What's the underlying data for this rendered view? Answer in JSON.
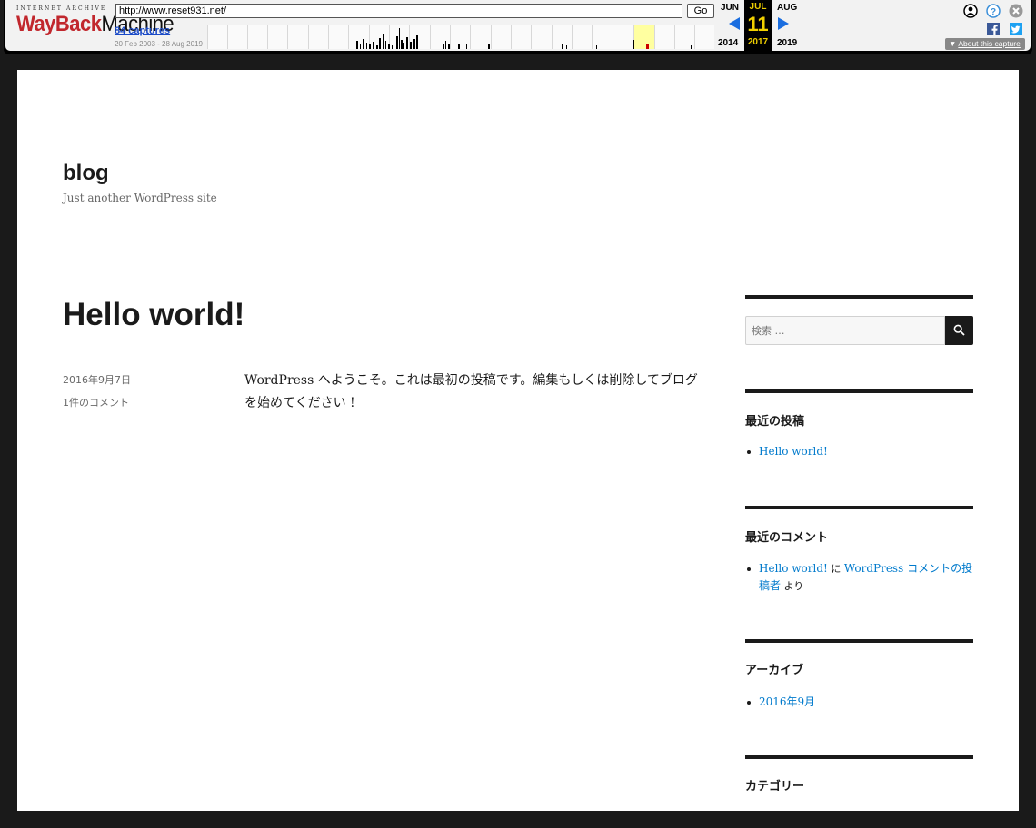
{
  "wayback": {
    "logo_top": "INTERNET ARCHIVE",
    "logo_red": "WayBack",
    "logo_black": "Machine",
    "url": "http://www.reset931.net/",
    "go_label": "Go",
    "captures_label": "84 captures",
    "date_range": "20 Feb 2003 - 28 Aug 2019",
    "prev_month": "JUN",
    "current_month": "JUL",
    "next_month": "AUG",
    "current_day": "11",
    "prev_year": "2014",
    "current_year": "2017",
    "next_year": "2019",
    "about_label": "About this capture",
    "accent_color": "#1a6ee0",
    "highlight_color": "#f0d000"
  },
  "site": {
    "title": "blog",
    "description": "Just another WordPress site"
  },
  "post": {
    "title": "Hello world!",
    "date": "2016年9月7日",
    "comments": "1件のコメント",
    "body": "WordPress へようこそ。これは最初の投稿です。編集もしくは削除してブログを始めてください !"
  },
  "sidebar": {
    "search_placeholder": "検索 …",
    "recent_posts": {
      "title": "最近の投稿",
      "items": [
        "Hello world!"
      ]
    },
    "recent_comments": {
      "title": "最近のコメント",
      "post_link": "Hello world!",
      "connector": " に ",
      "author_link": "WordPress コメントの投稿者",
      "suffix": " より"
    },
    "archives": {
      "title": "アーカイブ",
      "items": [
        "2016年9月"
      ]
    },
    "categories": {
      "title": "カテゴリー"
    }
  }
}
